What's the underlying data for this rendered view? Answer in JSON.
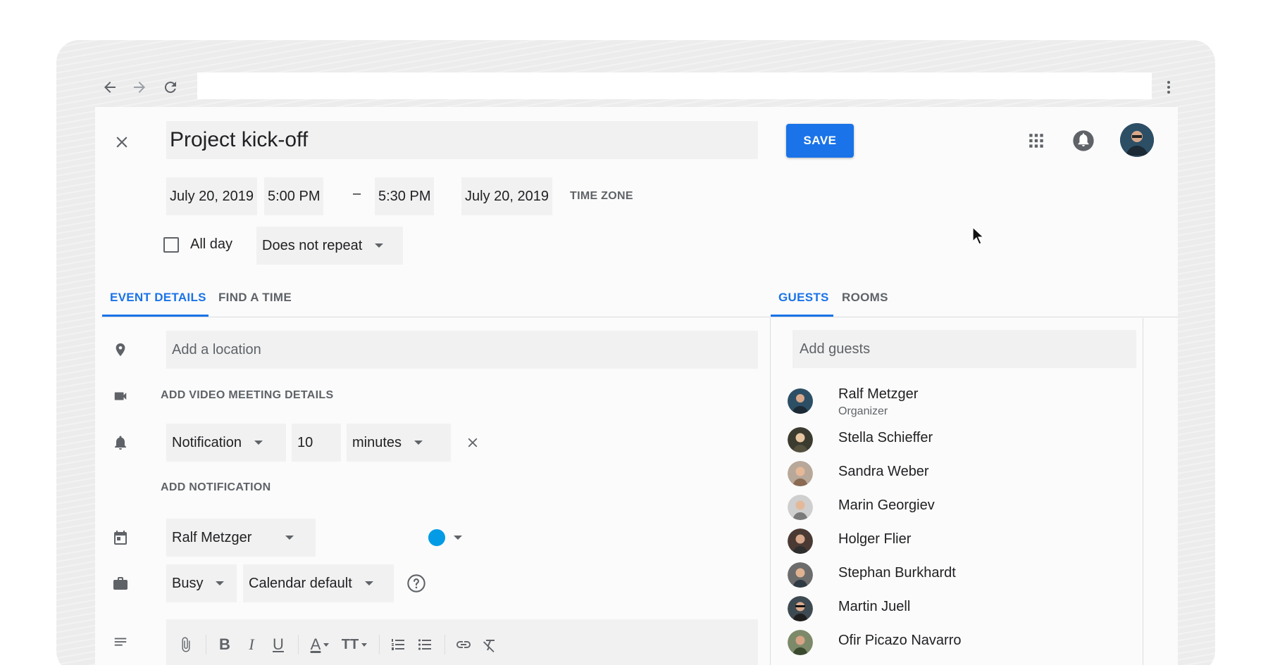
{
  "event": {
    "title": "Project kick-off",
    "save_label": "SAVE",
    "start_date": "July 20, 2019",
    "start_time": "5:00 PM",
    "separator": "–",
    "end_time": "5:30 PM",
    "end_date": "July 20, 2019",
    "time_zone_label": "TIME ZONE",
    "all_day_label": "All day",
    "repeat_value": "Does not repeat"
  },
  "tabs": {
    "left": [
      {
        "label": "EVENT DETAILS",
        "active": true
      },
      {
        "label": "FIND A TIME",
        "active": false
      }
    ],
    "right": [
      {
        "label": "GUESTS",
        "active": true
      },
      {
        "label": "ROOMS",
        "active": false
      }
    ]
  },
  "details": {
    "location_placeholder": "Add a location",
    "video_meeting_label": "ADD VIDEO MEETING DETAILS",
    "notification_type": "Notification",
    "notification_amount": "10",
    "notification_unit": "minutes",
    "add_notification_label": "ADD NOTIFICATION",
    "calendar_owner": "Ralf Metzger",
    "calendar_color": "#039be5",
    "availability": "Busy",
    "visibility": "Calendar default"
  },
  "toolbar": {
    "bold": "B",
    "italic": "I",
    "underline": "U",
    "text_color": "A",
    "text_size": "TT"
  },
  "guests": {
    "placeholder": "Add guests",
    "list": [
      {
        "name": "Ralf Metzger",
        "role": "Organizer"
      },
      {
        "name": "Stella Schieffer",
        "role": ""
      },
      {
        "name": "Sandra Weber",
        "role": ""
      },
      {
        "name": "Marin Georgiev",
        "role": ""
      },
      {
        "name": "Holger Flier",
        "role": ""
      },
      {
        "name": "Stephan Burkhardt",
        "role": ""
      },
      {
        "name": "Martin Juell",
        "role": ""
      },
      {
        "name": "Ofir Picazo Navarro",
        "role": ""
      }
    ]
  },
  "colors": {
    "accent": "#1a73e8",
    "save_button": "#1a73e8",
    "calendar_dot": "#039be5"
  },
  "icons": {
    "browser": [
      "back-arrow-icon",
      "forward-arrow-icon",
      "reload-icon",
      "more-vert-icon"
    ],
    "header": [
      "close-icon",
      "apps-grid-icon",
      "notifications-bell-icon",
      "account-avatar"
    ],
    "rows": [
      "location-pin-icon",
      "video-camera-icon",
      "bell-icon",
      "calendar-icon",
      "briefcase-icon",
      "description-lines-icon",
      "help-icon",
      "remove-x-icon"
    ],
    "toolbar": [
      "attachment-icon",
      "bold-icon",
      "italic-icon",
      "underline-icon",
      "text-color-icon",
      "text-size-icon",
      "numbered-list-icon",
      "bulleted-list-icon",
      "link-icon",
      "clear-formatting-icon"
    ]
  }
}
